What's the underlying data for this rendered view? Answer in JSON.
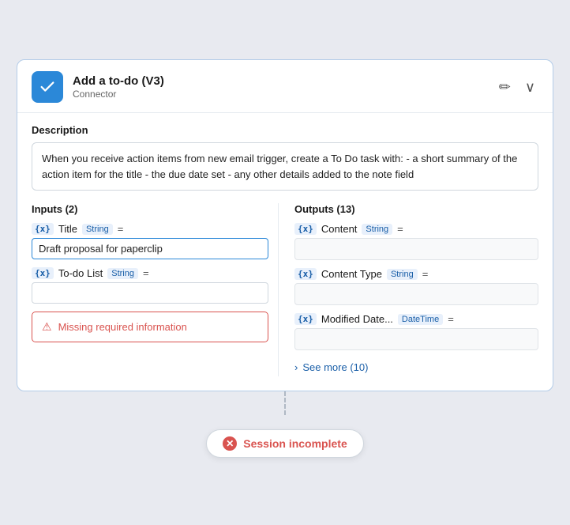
{
  "header": {
    "title": "Add a to-do (V3)",
    "subtitle": "Connector",
    "edit_icon": "✏",
    "expand_icon": "∨"
  },
  "description": {
    "label": "Description",
    "text": "When you receive action items from new email trigger, create a To Do task with: - a short summary of the action item for the title - the due date set - any other details added to the note field"
  },
  "inputs": {
    "section_title": "Inputs (2)",
    "fields": [
      {
        "var": "{x}",
        "name": "Title",
        "type": "String",
        "equals": "=",
        "value": "Draft proposal for paperclip",
        "active": true
      },
      {
        "var": "{x}",
        "name": "To-do List",
        "type": "String",
        "equals": "=",
        "value": "",
        "active": false
      }
    ],
    "error": {
      "text": "Missing required information"
    }
  },
  "outputs": {
    "section_title": "Outputs (13)",
    "fields": [
      {
        "var": "{x}",
        "name": "Content",
        "type": "String",
        "equals": "=",
        "value": ""
      },
      {
        "var": "{x}",
        "name": "Content Type",
        "type": "String",
        "equals": "=",
        "value": ""
      },
      {
        "var": "{x}",
        "name": "Modified Date...",
        "type": "DateTime",
        "equals": "=",
        "value": ""
      }
    ],
    "see_more": {
      "label": "See more (10)"
    }
  },
  "session": {
    "text": "Session incomplete",
    "error_symbol": "✕"
  }
}
